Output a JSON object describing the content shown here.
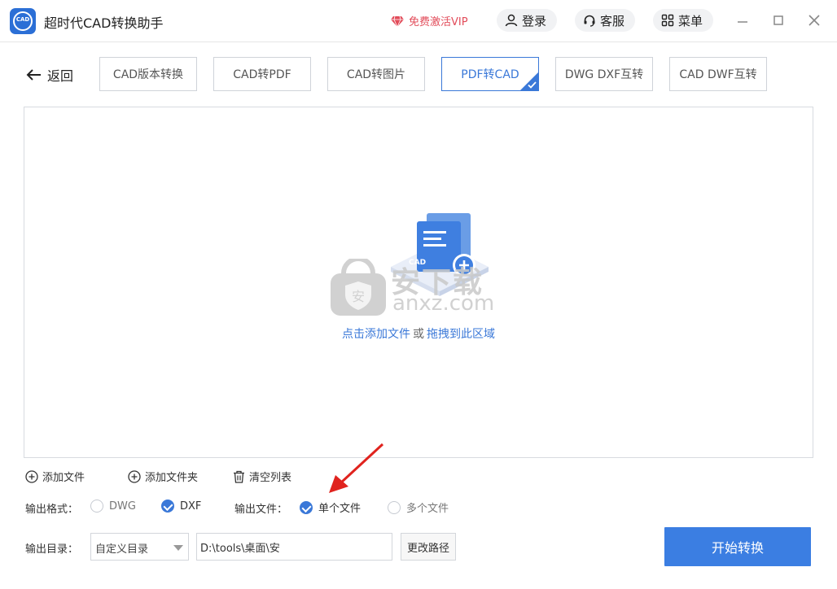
{
  "app": {
    "title": "超时代CAD转换助手",
    "logo_text": "CAD"
  },
  "header": {
    "vip_label": "免费激活VIP",
    "login_label": "登录",
    "service_label": "客服",
    "menu_label": "菜单"
  },
  "nav": {
    "back_label": "返回",
    "tabs": [
      {
        "label": "CAD版本转换",
        "active": false
      },
      {
        "label": "CAD转PDF",
        "active": false
      },
      {
        "label": "CAD转图片",
        "active": false
      },
      {
        "label": "PDF转CAD",
        "active": true
      },
      {
        "label": "DWG DXF互转",
        "active": false
      },
      {
        "label": "CAD DWF互转",
        "active": false
      }
    ]
  },
  "dropzone": {
    "icon_label": "CAD",
    "click_text": "点击添加文件",
    "or_text": "或",
    "drag_text": "拖拽到此区域"
  },
  "watermark": {
    "text": "安下载",
    "url": "anxz.com"
  },
  "actions": {
    "add_file": "添加文件",
    "add_folder": "添加文件夹",
    "clear_list": "清空列表"
  },
  "options": {
    "format_label": "输出格式：",
    "formats": [
      {
        "label": "DWG",
        "checked": false
      },
      {
        "label": "DXF",
        "checked": true
      }
    ],
    "file_label": "输出文件：",
    "file_modes": [
      {
        "label": "单个文件",
        "checked": true
      },
      {
        "label": "多个文件",
        "checked": false
      }
    ]
  },
  "output": {
    "dir_label": "输出目录：",
    "dir_mode": "自定义目录",
    "path_value": "D:\\tools\\桌面\\安",
    "change_label": "更改路径",
    "start_label": "开始转换"
  },
  "colors": {
    "accent": "#3a78d8",
    "vip": "#e24c5a",
    "start_button": "#3b7ee2"
  }
}
